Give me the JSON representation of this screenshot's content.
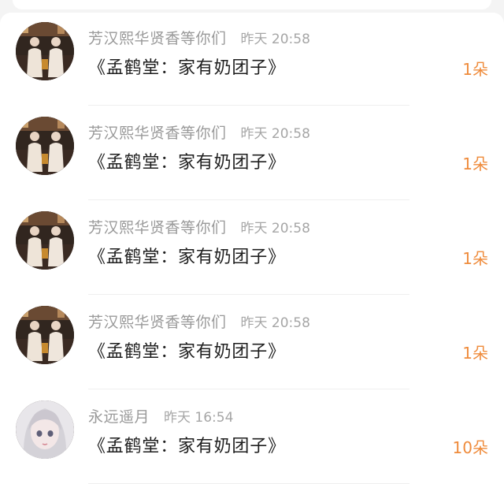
{
  "gift_list": [
    {
      "username": "芳汉熙华贤香等你们",
      "time": "昨天 20:58",
      "message": "《孟鹤堂：家有奶团子》",
      "count": "1朵",
      "avatar_icon": "duo-performers-avatar-icon"
    },
    {
      "username": "芳汉熙华贤香等你们",
      "time": "昨天 20:58",
      "message": "《孟鹤堂：家有奶团子》",
      "count": "1朵",
      "avatar_icon": "duo-performers-avatar-icon"
    },
    {
      "username": "芳汉熙华贤香等你们",
      "time": "昨天 20:58",
      "message": "《孟鹤堂：家有奶团子》",
      "count": "1朵",
      "avatar_icon": "duo-performers-avatar-icon"
    },
    {
      "username": "芳汉熙华贤香等你们",
      "time": "昨天 20:58",
      "message": "《孟鹤堂：家有奶团子》",
      "count": "1朵",
      "avatar_icon": "duo-performers-avatar-icon"
    },
    {
      "username": "永远遥月",
      "time": "昨天 16:54",
      "message": "《孟鹤堂：家有奶团子》",
      "count": "10朵",
      "avatar_icon": "anime-girl-avatar-icon"
    }
  ],
  "colors": {
    "accent": "#ef8b3b",
    "username": "#9a9a9a",
    "time": "#a6a6a6",
    "message": "#1f1f1f"
  }
}
